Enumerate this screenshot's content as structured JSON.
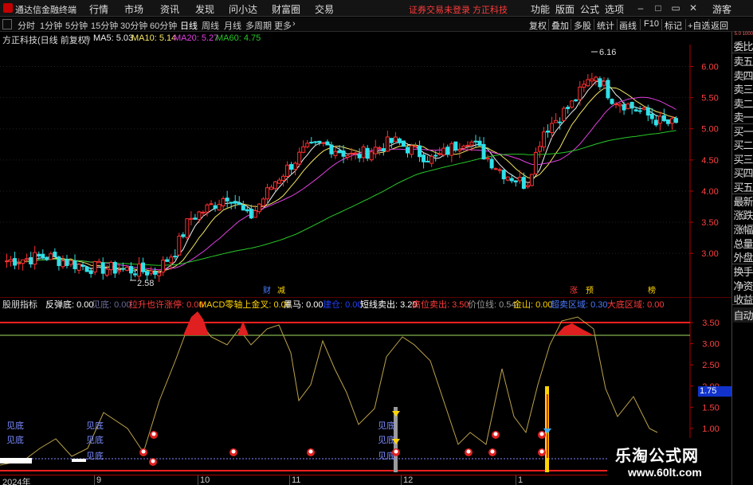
{
  "titlebar": {
    "app_name": "通达信金融终端",
    "menus": [
      "行情",
      "市场",
      "资讯",
      "发现",
      "问小达",
      "财富圈",
      "交易"
    ],
    "notice": "证券交易未登录  方正科技",
    "right_menus": [
      "功能",
      "版面",
      "公式",
      "选项"
    ],
    "guest": "游客"
  },
  "periodbar": {
    "periods": [
      "分时",
      "1分钟",
      "5分钟",
      "15分钟",
      "30分钟",
      "60分钟",
      "日线",
      "周线",
      "月线",
      "多周期",
      "更多"
    ],
    "active_period": "日线",
    "right_buttons": [
      "复权",
      "叠加",
      "多股",
      "统计",
      "画线",
      "F10",
      "标记",
      "+自选",
      "返回"
    ]
  },
  "main": {
    "stock_name": "方正科技(日线 前复权)",
    "ma": [
      {
        "label": "MA5: 5.03",
        "color": "#f0f0f0"
      },
      {
        "label": "MA10: 5.14",
        "color": "#f5e663"
      },
      {
        "label": "MA20: 5.27",
        "color": "#e040e0"
      },
      {
        "label": "MA60: 4.75",
        "color": "#28c828"
      }
    ],
    "yaxis": [
      "6.00",
      "5.50",
      "5.00",
      "4.50",
      "4.00",
      "3.50",
      "3.00"
    ],
    "high_label": "6.16",
    "low_label": "2.58",
    "event_tags": [
      {
        "text": "财",
        "color": "#4a7aff"
      },
      {
        "text": "减",
        "color": "#ffd400"
      },
      {
        "text": "涨",
        "color": "#ff3b3b"
      },
      {
        "text": "预",
        "color": "#ffd400"
      },
      {
        "text": "榜",
        "color": "#ffd400"
      }
    ]
  },
  "indicator": {
    "name": "股朋指标",
    "items": [
      {
        "label": "反弹底: 0.00",
        "color": "#ffffff"
      },
      {
        "label": "见底: 0.00",
        "color": "#6a6a9a"
      },
      {
        "label": "拉升也许涨停: 0.00",
        "color": "#ff3b3b"
      },
      {
        "label": "MACD零轴上金叉: 0.00",
        "color": "#ffd400"
      },
      {
        "label": "黑马: 0.00",
        "color": "#ffffff"
      },
      {
        "label": "建仓: 0.00",
        "color": "#2040ff"
      },
      {
        "label": "短线卖出: 3.20",
        "color": "#ffffff"
      },
      {
        "label": "高位卖出: 3.50",
        "color": "#ff3b3b"
      },
      {
        "label": "价位线: 0.54",
        "color": "#9a9a9a"
      },
      {
        "label": "金山: 0.00",
        "color": "#ffd400"
      },
      {
        "label": "超卖区域: 0.30",
        "color": "#4a7aff"
      },
      {
        "label": "大底区域: 0.00",
        "color": "#ff3b3b"
      }
    ],
    "yaxis": [
      "3.50",
      "3.00",
      "2.50",
      "2.00",
      "1.50",
      "1.00"
    ],
    "current_tag": "1.75",
    "signal_label": "见底"
  },
  "sidebar": {
    "top_label": "5.0 1000",
    "items": [
      "委比",
      "卖五",
      "卖四",
      "卖三",
      "卖二",
      "卖一",
      "买一",
      "买二",
      "买三",
      "买四",
      "买五",
      "最新",
      "涨跌",
      "涨幅",
      "总量",
      "外盘",
      "换手",
      "净资",
      "收益",
      "自动"
    ]
  },
  "xaxis": {
    "labels": [
      "2024年",
      "9",
      "10",
      "11",
      "12",
      "1"
    ]
  },
  "watermark": {
    "title": "乐淘公式网",
    "url": "www.60lt.com"
  }
}
